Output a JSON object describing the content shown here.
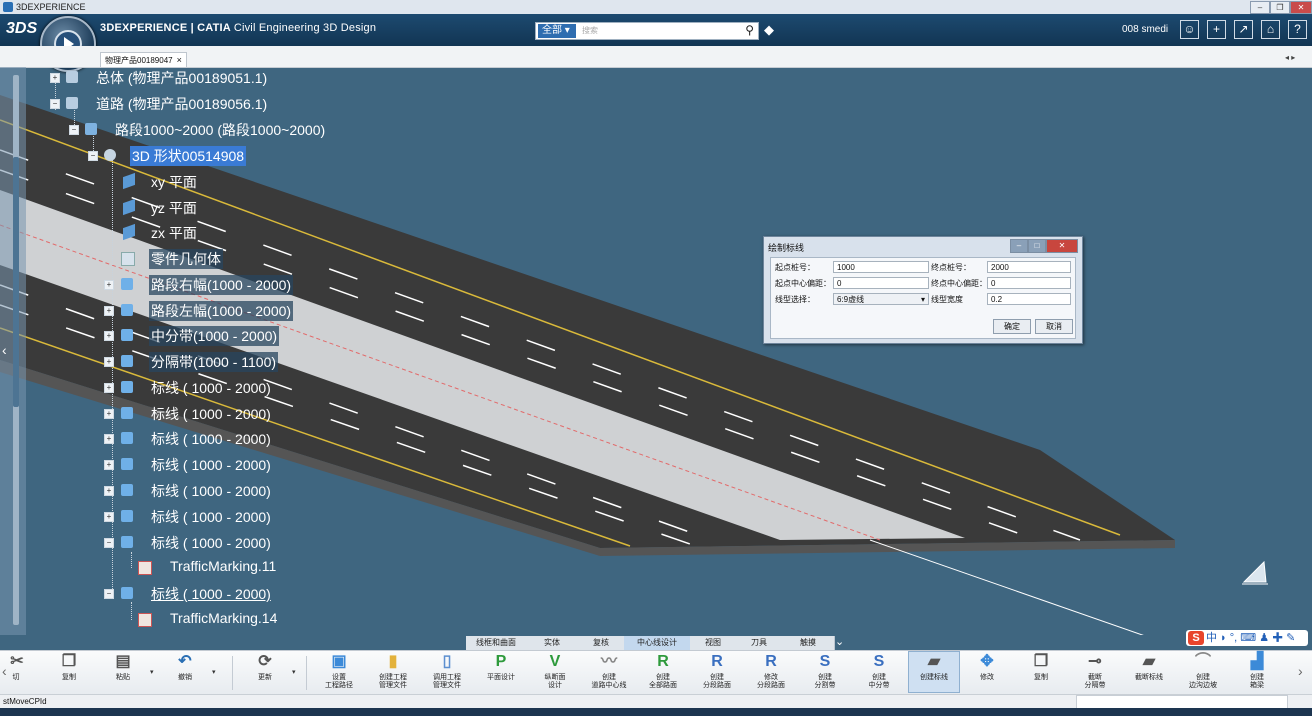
{
  "window": {
    "title": "3DEXPERIENCE"
  },
  "header": {
    "brand_bold": "3DEXPERIENCE | CATIA",
    "brand_app": "Civil Engineering 3D Design",
    "logo": "3DS",
    "search_scope": "全部",
    "search_placeholder": "搜索",
    "user": "008 smedi",
    "icons": [
      "user-icon",
      "plus-icon",
      "share-icon",
      "home-icon",
      "help-icon"
    ]
  },
  "tab": {
    "label": "物理产品00189047",
    "close": "×"
  },
  "tree": {
    "n1": "总体 (物理产品00189051.1)",
    "n2": "道路 (物理产品00189056.1)",
    "n3": "路段1000~2000 (路段1000~2000)",
    "n4": "3D 形状00514908",
    "n5": "xy 平面",
    "n6": "yz 平面",
    "n7": "zx 平面",
    "n8": "零件几何体",
    "n9": "路段右幅(1000 - 2000)",
    "n10": "路段左幅(1000 - 2000)",
    "n11": "中分带(1000 - 2000)",
    "n12": "分隔带(1000 - 1100)",
    "n13": "标线 ( 1000 - 2000)",
    "n14": "标线 ( 1000 - 2000)",
    "n15": "标线 ( 1000 - 2000)",
    "n16": "标线 ( 1000 - 2000)",
    "n17": "标线 ( 1000 - 2000)",
    "n18": "标线 ( 1000 - 2000)",
    "n19": "标线 ( 1000 - 2000)",
    "n20": "TrafficMarking.11",
    "n21": "标线 ( 1000 - 2000)",
    "n22": "TrafficMarking.14"
  },
  "dialog": {
    "title": "绘制标线",
    "start_label": "起点桩号：",
    "start_value": "1000",
    "end_label": "终点桩号：",
    "end_value": "2000",
    "start_offset_label": "起点中心偏距：",
    "start_offset_value": "0",
    "end_offset_label": "终点中心偏距：",
    "end_offset_value": "0",
    "line_type_label": "线型选择：",
    "line_type_value": "6:9虚线",
    "line_width_label": "线型宽度",
    "line_width_value": "0.2",
    "ok": "确定",
    "cancel": "取消"
  },
  "bottom_tabs": [
    "线框和曲面",
    "实体",
    "复核",
    "中心线设计",
    "视图",
    "刀具",
    "触摸"
  ],
  "active_bottom_tab": "中心线设计",
  "toolbar": {
    "cut": "切",
    "copy": "复制",
    "paste": "粘贴",
    "undo": "撤销",
    "update": "更新",
    "t1": "设置\n工程路径",
    "t2": "创建工程\n管理文件",
    "t3": "调用工程\n管理文件",
    "t4": "平面设计",
    "t5": "纵断面\n设计",
    "t6": "创建\n道路中心线",
    "t7": "创建\n全部路面",
    "t8": "创建\n分段路面",
    "t9": "修改\n分段路面",
    "t10": "创建\n分割带",
    "t11": "创建\n中分带",
    "t12": "创建标线",
    "t13": "修改",
    "t14": "复制",
    "t15": "截断\n分隔带",
    "t16": "截断标线",
    "t17": "创建\n边沟边坡",
    "t18": "创建\n箱梁"
  },
  "status": {
    "text": "stMoveCPId"
  },
  "ime": {
    "label": "中"
  },
  "colors": {
    "header": "#123553",
    "viewport": "#3f6680",
    "selection": "#3a7bd5",
    "road": "#3a3a3a"
  }
}
